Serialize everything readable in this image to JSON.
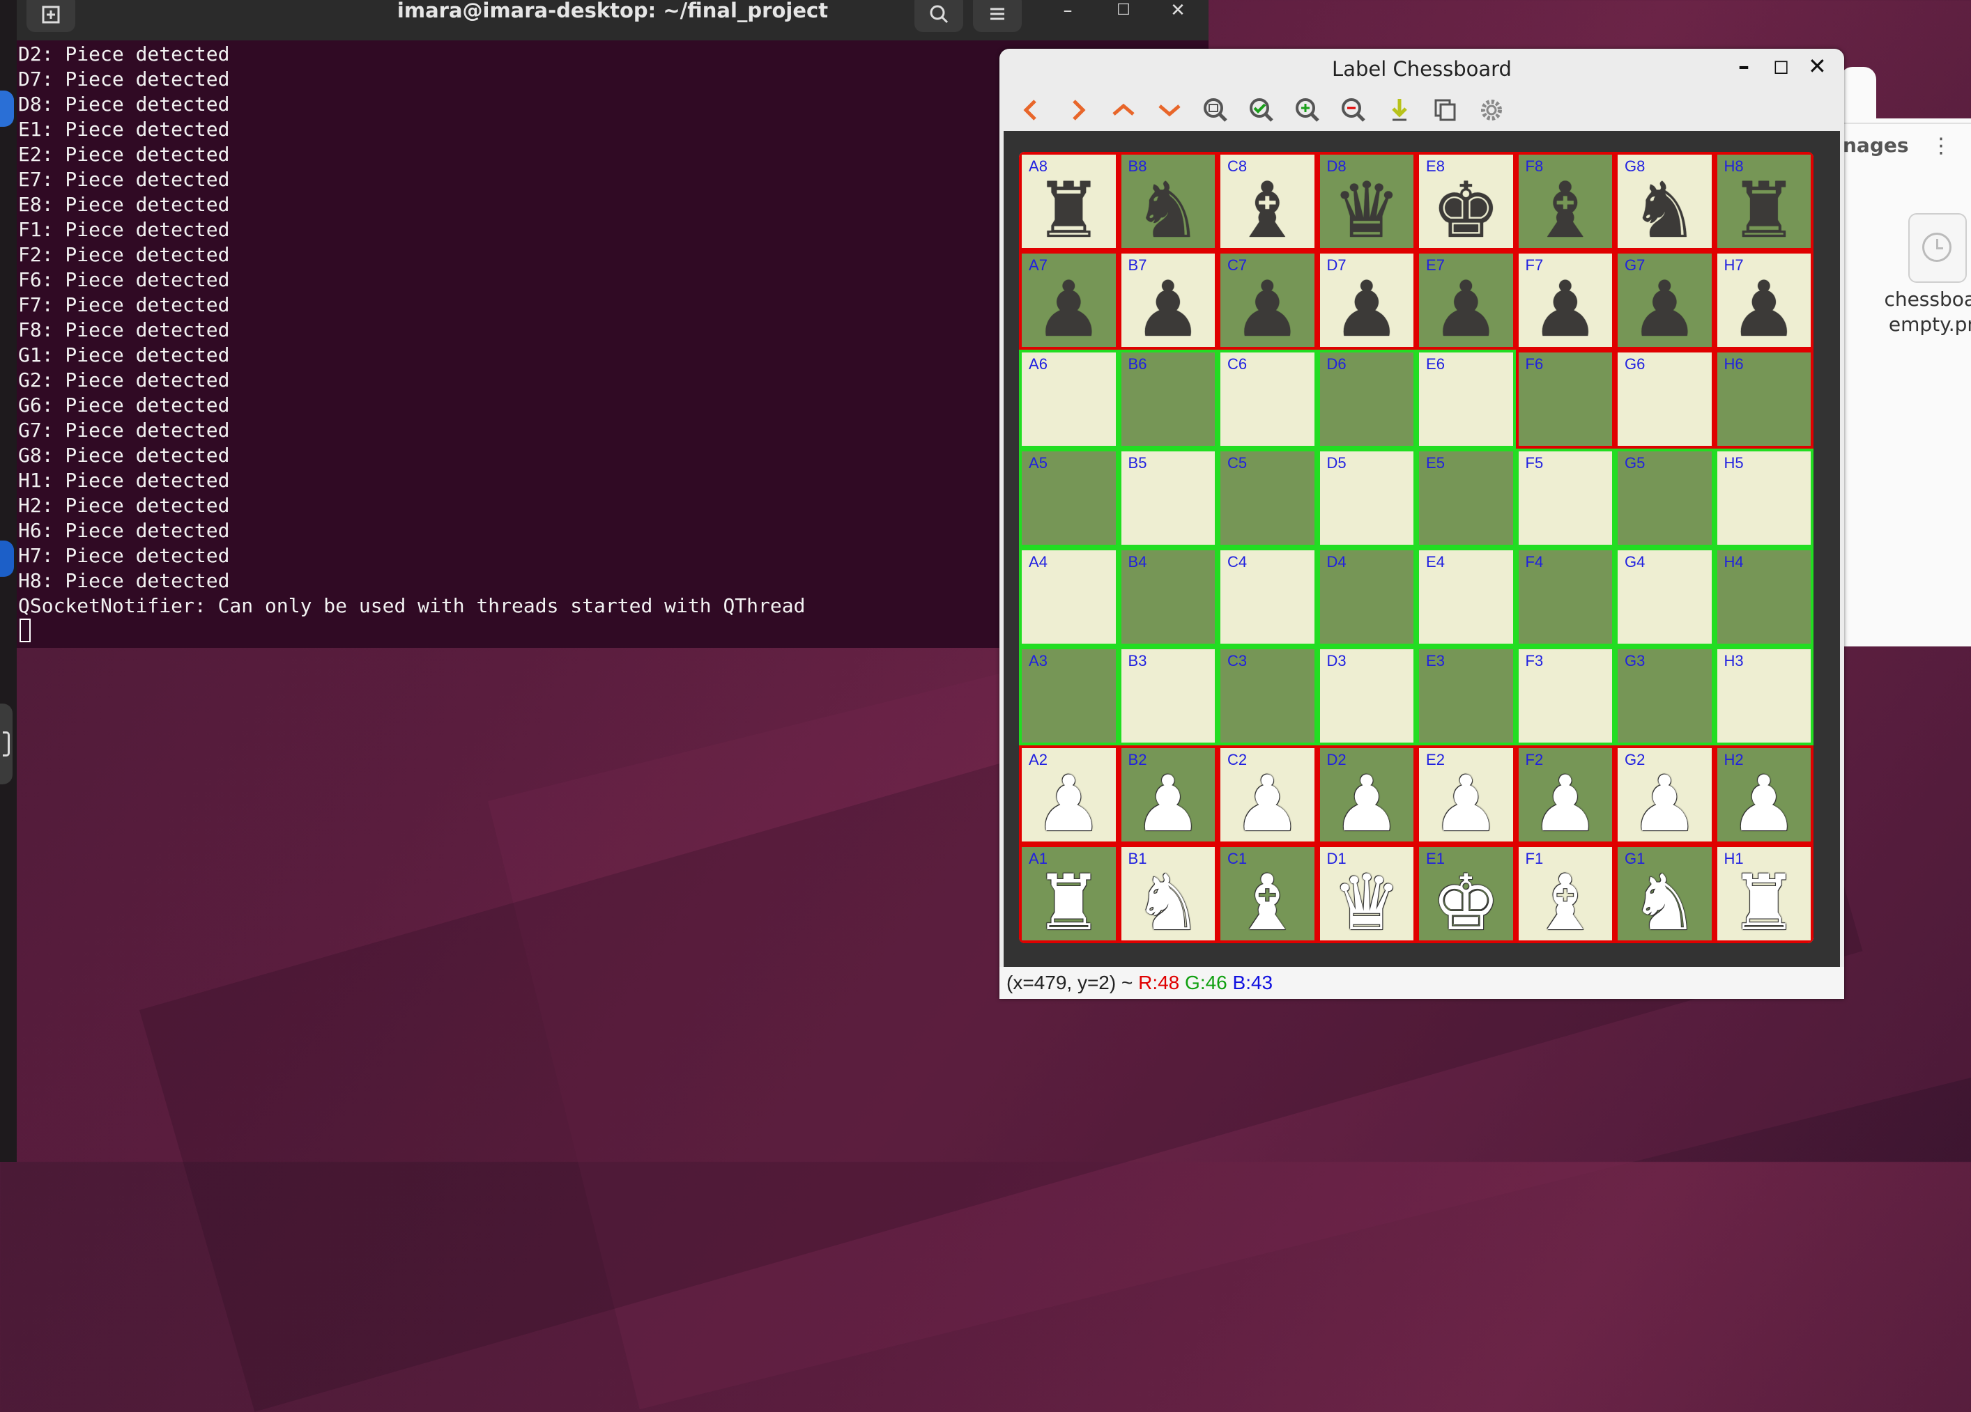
{
  "terminal": {
    "title": "imara@imara-desktop: ~/final_project",
    "lines": [
      "D2: Piece detected",
      "D7: Piece detected",
      "D8: Piece detected",
      "E1: Piece detected",
      "E2: Piece detected",
      "E7: Piece detected",
      "E8: Piece detected",
      "F1: Piece detected",
      "F2: Piece detected",
      "F6: Piece detected",
      "F7: Piece detected",
      "F8: Piece detected",
      "G1: Piece detected",
      "G2: Piece detected",
      "G6: Piece detected",
      "G7: Piece detected",
      "G8: Piece detected",
      "H1: Piece detected",
      "H2: Piece detected",
      "H6: Piece detected",
      "H7: Piece detected",
      "H8: Piece detected",
      "QSocketNotifier: Can only be used with threads started with QThread"
    ]
  },
  "files_panel": {
    "title_fragment": "nages",
    "menu_icon": "⋮",
    "file_name_line1": "chessboar",
    "file_name_line2": "empty.pn"
  },
  "label_window": {
    "title": "Label Chessboard",
    "toolbar_icons": [
      "prev-arrow-icon",
      "next-arrow-icon",
      "up-arrow-icon",
      "down-arrow-icon",
      "fit-zoom-icon",
      "check-icon",
      "zoom-in-icon",
      "zoom-out-icon",
      "download-icon",
      "copy-icon",
      "settings-gear-icon"
    ],
    "status": {
      "coords": "(x=479, y=2) ~ ",
      "r": "R:48",
      "g": "G:46",
      "b": "B:43"
    }
  },
  "colors": {
    "light_square": "#eeeed2",
    "dark_square": "#769656",
    "highlight_red": "#e00000",
    "highlight_green": "#22dd22",
    "label_blue": "#2020e0"
  },
  "board": {
    "files": [
      "A",
      "B",
      "C",
      "D",
      "E",
      "F",
      "G",
      "H"
    ],
    "rows": [
      {
        "rank": 8,
        "pieces": [
          "♜",
          "♞",
          "♝",
          "♛",
          "♚",
          "♝",
          "♞",
          "♜"
        ],
        "white": false
      },
      {
        "rank": 7,
        "pieces": [
          "♟",
          "♟",
          "♟",
          "♟",
          "♟",
          "♟",
          "♟",
          "♟"
        ],
        "white": false
      },
      {
        "rank": 6,
        "pieces": [
          "",
          "",
          "",
          "",
          "",
          "",
          "",
          ""
        ],
        "white": false
      },
      {
        "rank": 5,
        "pieces": [
          "",
          "",
          "",
          "",
          "",
          "",
          "",
          ""
        ],
        "white": false
      },
      {
        "rank": 4,
        "pieces": [
          "",
          "",
          "",
          "",
          "",
          "",
          "",
          ""
        ],
        "white": false
      },
      {
        "rank": 3,
        "pieces": [
          "",
          "",
          "",
          "",
          "",
          "",
          "",
          ""
        ],
        "white": false
      },
      {
        "rank": 2,
        "pieces": [
          "♟",
          "♟",
          "♟",
          "♟",
          "♟",
          "♟",
          "♟",
          "♟"
        ],
        "white": true
      },
      {
        "rank": 1,
        "pieces": [
          "♜",
          "♞",
          "♝",
          "♛",
          "♚",
          "♝",
          "♞",
          "♜"
        ],
        "white": true
      }
    ],
    "detected": [
      "A8",
      "B8",
      "C8",
      "D8",
      "E8",
      "F8",
      "G8",
      "H8",
      "A7",
      "B7",
      "C7",
      "D7",
      "E7",
      "F7",
      "G7",
      "H7",
      "F6",
      "G6",
      "H6",
      "A2",
      "B2",
      "C2",
      "D2",
      "E2",
      "F2",
      "G2",
      "H2",
      "A1",
      "B1",
      "C1",
      "D1",
      "E1",
      "F1",
      "G1",
      "H1"
    ]
  }
}
